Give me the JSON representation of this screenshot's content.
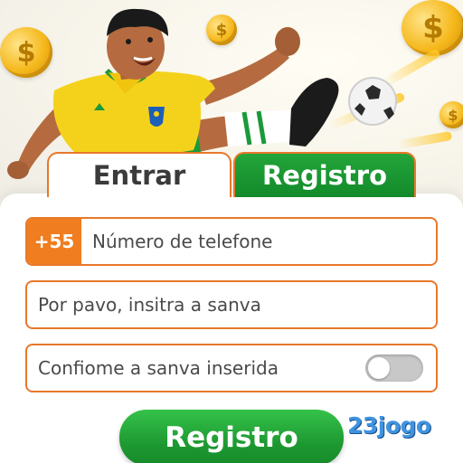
{
  "tabs": {
    "login_label": "Entrar",
    "register_label": "Registro"
  },
  "phone": {
    "prefix": "+55",
    "placeholder": "Número de telefone"
  },
  "password": {
    "placeholder": "Por pavo, insitra a sanva"
  },
  "confirm": {
    "placeholder": "Confiome a sanva inserida",
    "toggle_on": false
  },
  "submit": {
    "label": "Registro"
  },
  "brand": {
    "name": "23jogo"
  },
  "colors": {
    "accent_orange": "#e8782a",
    "primary_green": "#1e9a32",
    "brand_blue": "#3f93e0"
  },
  "icons": {
    "coin": "dollar-coin-icon",
    "ball": "soccer-ball-icon",
    "toggle": "toggle-switch-icon"
  }
}
